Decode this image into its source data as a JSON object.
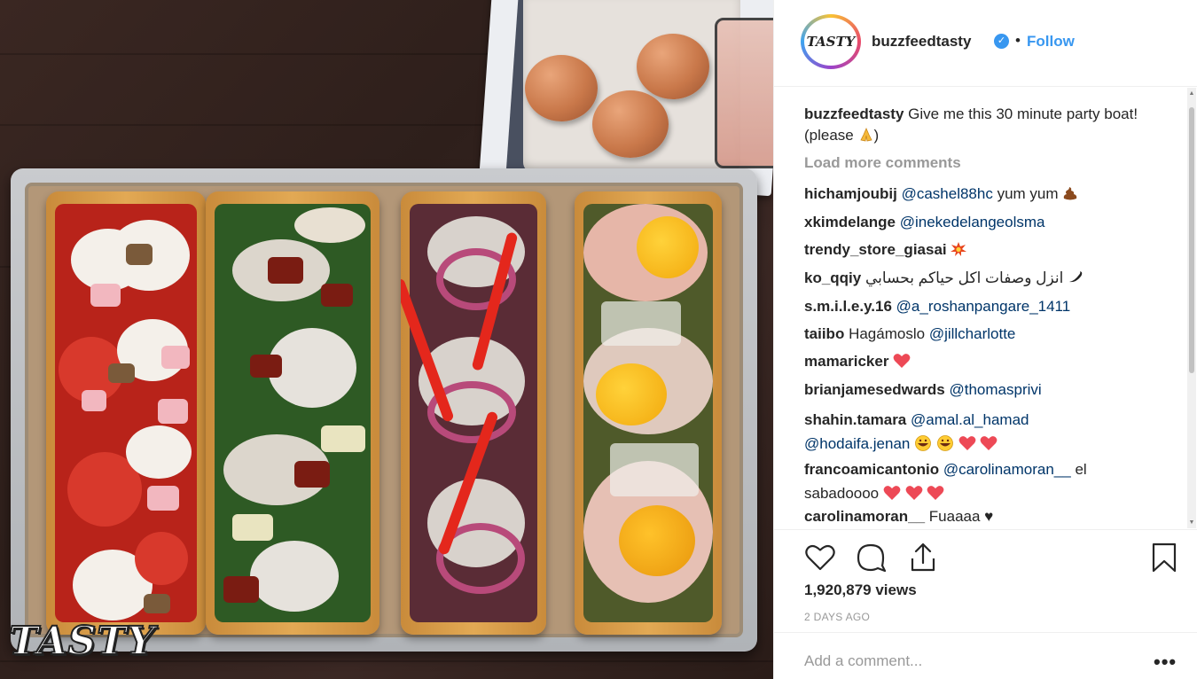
{
  "media": {
    "watermark": "TASTY"
  },
  "post": {
    "avatar_text": "TASTY",
    "username": "buzzfeedtasty",
    "verified_icon": "verified-badge-icon",
    "separator": "•",
    "follow_label": "Follow",
    "caption_user": "buzzfeedtasty",
    "caption_text": "Give me this 30 minute party boat! (please",
    "caption_end": ")",
    "load_more": "Load more comments",
    "views": "1,920,879 views",
    "date": "2 DAYS AGO",
    "add_comment_placeholder": "Add a comment...",
    "more_label": "•••"
  },
  "comments": [
    {
      "user": "hichamjoubij",
      "mention": "@cashel88hc",
      "text": "yum yum"
    },
    {
      "user": "xkimdelange",
      "mention": "@inekedelangeolsma",
      "text": ""
    },
    {
      "user": "trendy_store_giasai",
      "mention": "",
      "text": ""
    },
    {
      "user": "ko_qqiy",
      "mention": "",
      "text": "انزل وصفات اكل حياكم بحسابي"
    },
    {
      "user": "s.m.i.l.e.y.16",
      "mention": "@a_roshanpangare_1411",
      "text": ""
    },
    {
      "user": "taiibo",
      "mention": "@jillcharlotte",
      "text": "Hagámoslo"
    },
    {
      "user": "mamaricker",
      "mention": "",
      "text": ""
    },
    {
      "user": "brianjamesedwards",
      "mention": "@thomasprivi",
      "text": ""
    },
    {
      "user": "shahin.tamara",
      "mention": "@amal.al_hamad",
      "mention2": "@hodaifa.jenan",
      "text": ""
    },
    {
      "user": "francoamicantonio",
      "mention": "@carolinamoran__",
      "text": "el",
      "text2": "sabadoooo"
    },
    {
      "user": "carolinamoran__",
      "mention": "",
      "text": "Fuaaaa ♥"
    }
  ],
  "colors": {
    "accent": "#3897f0",
    "mention": "#003569",
    "heart": "#ed4956"
  }
}
